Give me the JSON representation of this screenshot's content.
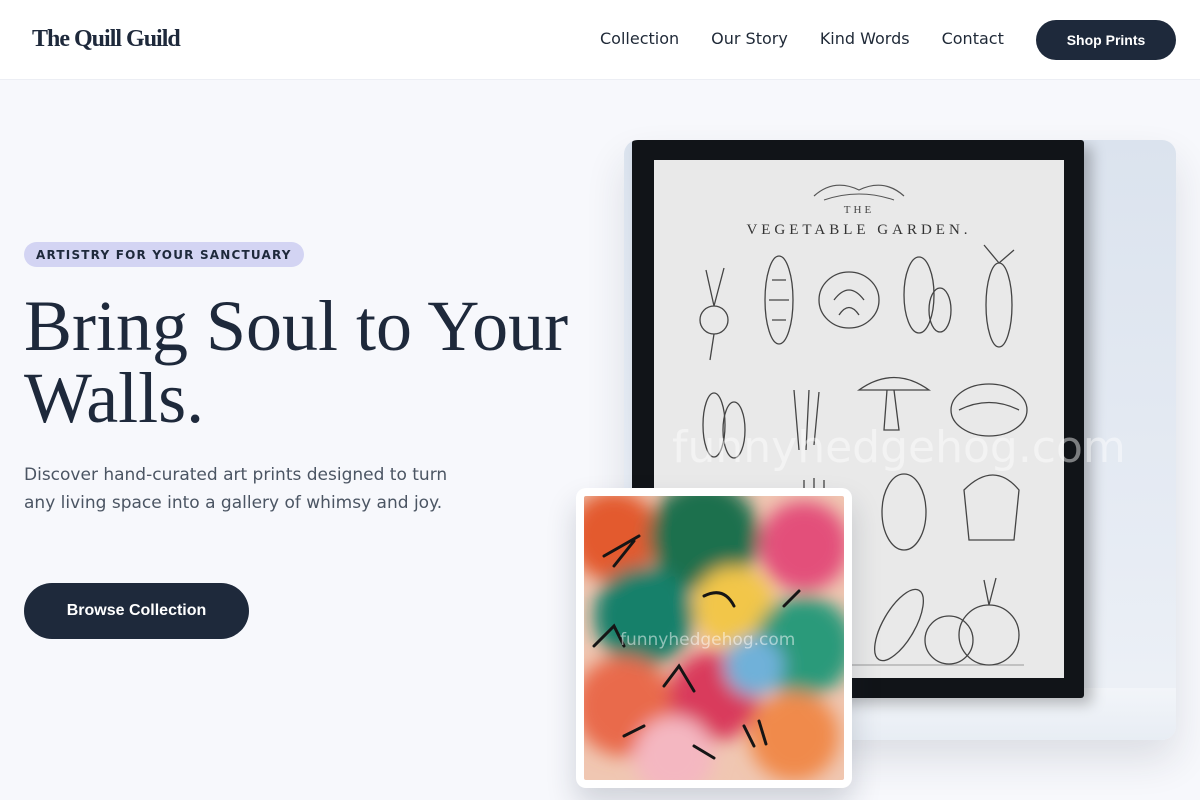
{
  "nav": {
    "logo": "The Quill Guild",
    "links": [
      "Collection",
      "Our Story",
      "Kind Words",
      "Contact"
    ],
    "cta": "Shop Prints"
  },
  "hero": {
    "eyebrow": "ARTISTRY FOR YOUR SANCTUARY",
    "headline": "Bring Soul to Your Walls.",
    "subtext": "Discover hand-curated art prints designed to turn any living space into a gallery of whimsy and joy.",
    "cta": "Browse Collection"
  },
  "artwork": {
    "poster_the": "THE",
    "poster_title": "VEGETABLE GARDEN.",
    "watermark": "funnyhedgehog.com"
  },
  "colors": {
    "primary": "#1e293b",
    "eyebrow_bg": "#d3d4f3",
    "page_bg": "#f7f8fc"
  }
}
